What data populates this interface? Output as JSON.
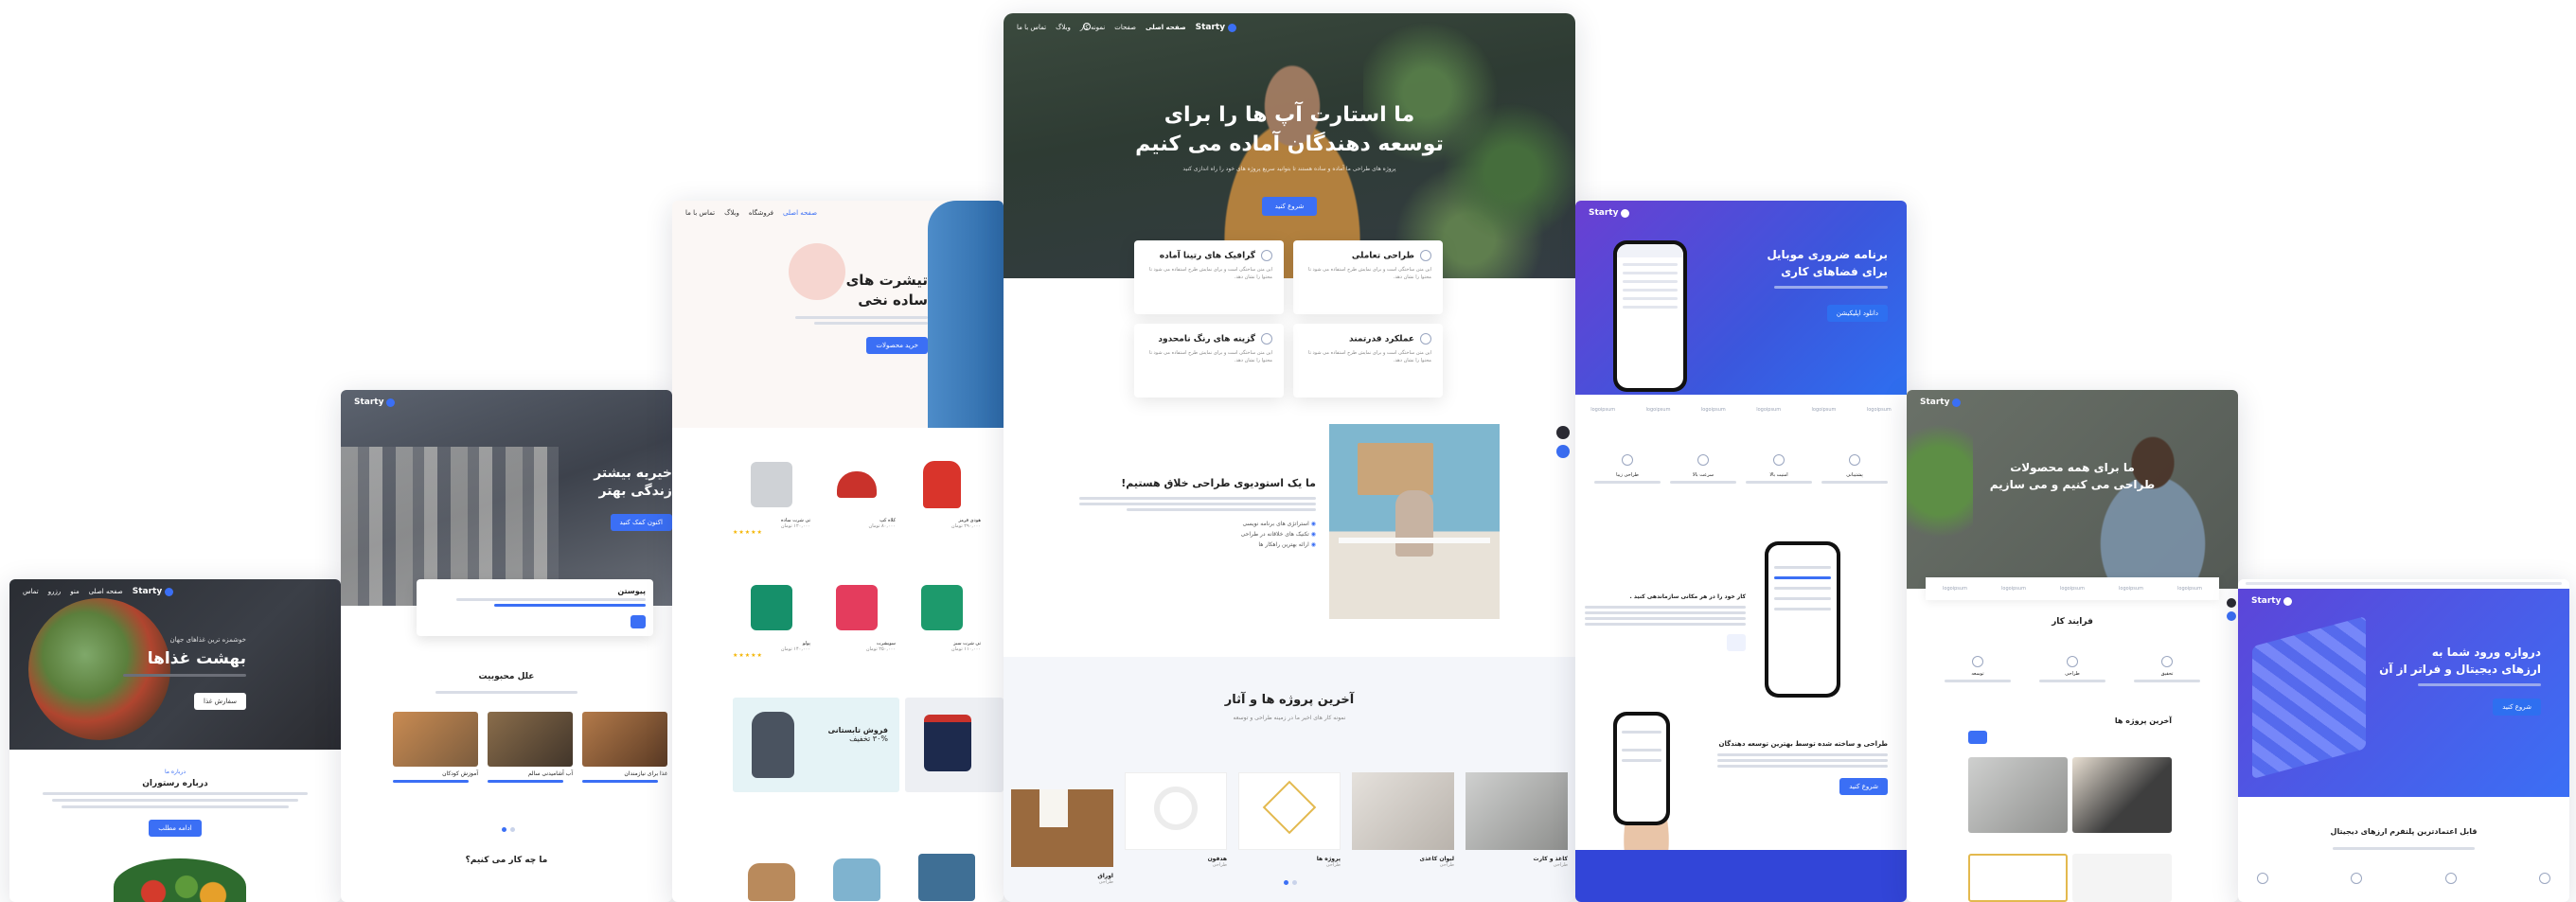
{
  "brand": "Starty",
  "colors": {
    "accent": "#3b6ff5",
    "purple": "#5b3fd6",
    "dark": "#2b2b33"
  },
  "main_hero": {
    "nav": [
      "صفحه اصلی",
      "صفحات",
      "نمونه کار",
      "وبلاگ",
      "تماس با ما"
    ],
    "title_line1": "ما استارت آپ ها را برای",
    "title_line2": "توسعه دهندگان آماده می کنیم",
    "subtitle": "پروژه های طراحی ما آماده و ساده هستند تا بتوانید سریع پروژه های خود را راه اندازی کنید",
    "cta": "شروع کنید"
  },
  "features": [
    {
      "title": "طراحی تعاملی",
      "text": "این متن ساختگی است و برای نمایش طرح استفاده می شود تا محتوا را نشان دهد."
    },
    {
      "title": "گرافیک های رتینا آماده",
      "text": "این متن ساختگی است و برای نمایش طرح استفاده می شود تا محتوا را نشان دهد."
    },
    {
      "title": "عملکرد قدرتمند",
      "text": "این متن ساختگی است و برای نمایش طرح استفاده می شود تا محتوا را نشان دهد."
    },
    {
      "title": "گزینه های رنگ نامحدود",
      "text": "این متن ساختگی است و برای نمایش طرح استفاده می شود تا محتوا را نشان دهد."
    }
  ],
  "studio": {
    "title": "ما یک استودیوی طراحی خلاق هستیم!",
    "points": [
      "استراتژی های برنامه نویسی",
      "تکنیک های خلاقانه در طراحی",
      "ارائه بهترین راهکار ها"
    ]
  },
  "projects": {
    "title": "آخرین پروژه ها و آثار",
    "subtitle": "نمونه کار های اخیر ما در زمینه طراحی و توسعه",
    "items": [
      {
        "name": "کاغذ و کارت",
        "cat": "طراحی"
      },
      {
        "name": "لیوان کاغذی",
        "cat": "طراحی"
      },
      {
        "name": "پروژه ها",
        "cat": "طراحی"
      },
      {
        "name": "هدفون",
        "cat": "طراحی"
      },
      {
        "name": "اوراق",
        "cat": "طراحی"
      }
    ]
  },
  "shop": {
    "title_line1": "تیشرت های",
    "title_line2": "ساده نخی",
    "cta": "خرید محصولات",
    "nav": [
      "صفحه اصلی",
      "فروشگاه",
      "وبلاگ",
      "تماس با ما"
    ],
    "products": [
      {
        "name": "هودی قرمز",
        "price": "۲۹۰,۰۰۰ تومان"
      },
      {
        "name": "کلاه کپ",
        "price": "۸۰,۰۰۰ تومان"
      },
      {
        "name": "تی شرت ساده",
        "price": "۱۲۰,۰۰۰ تومان"
      },
      {
        "name": "تی شرت سبز",
        "price": "۱۱۰,۰۰۰ تومان"
      },
      {
        "name": "سویشرت",
        "price": "۲۵۰,۰۰۰ تومان"
      },
      {
        "name": "پولو",
        "price": "۱۴۰,۰۰۰ تومان"
      }
    ],
    "promo_title": "فروش تابستانی",
    "promo_sub": "۳۰% تخفیف"
  },
  "charity": {
    "title_line1": "خیریه بیشتر",
    "title_line2": "زندگی بهتر",
    "cta": "اکنون کمک کنید",
    "donate_title": "پیوستن",
    "causes_title": "علل محبوبیت",
    "causes": [
      "آموزش کودکان",
      "آب آشامیدنی سالم",
      "غذا برای نیازمندان"
    ],
    "bottom_title": "ما چه کار می کنیم؟"
  },
  "food": {
    "nav": [
      "صفحه اصلی",
      "منو",
      "رزرو",
      "تماس"
    ],
    "kicker": "خوشمزه ترین غذاهای جهان",
    "title": "بهشت غذاها",
    "cta": "سفارش غذا",
    "about_kicker": "درباره ما",
    "about_title": "درباره رستوران",
    "about_btn": "ادامه مطلب"
  },
  "app": {
    "title_line1": "برنامه ضروری موبایل",
    "title_line2": "برای فضاهای کاری",
    "cta": "دانلود اپلیکیشن",
    "partners": [
      "logoipsum",
      "logoipsum",
      "logoipsum",
      "logoipsum",
      "logoipsum",
      "logoipsum"
    ],
    "features": [
      "پشتیبانی",
      "امنیت بالا",
      "سرعت بالا",
      "طراحی زیبا"
    ],
    "section_title": "کار خود را در هر مکانی سازماندهی کنید .",
    "section2_title": "طراحی و ساخته شده توسط بهترین توسعه دهندگان",
    "btn": "شروع کنید"
  },
  "freelance": {
    "title_line1": "ما برای همه محصولات",
    "title_line2": "طراحی می کنیم و می سازیم",
    "process_title": "فرایند کار",
    "steps": [
      "تحقیق",
      "طراحی",
      "توسعه"
    ],
    "projects_title": "آخرین پروژه ها"
  },
  "agency": {
    "title_line1": "دروازه ورود شما به",
    "title_line2": "ارزهای دیجیتال و فراتر از آن",
    "cta": "شروع کنید",
    "section_title": "قابل اعتمادترین پلتفرم ارزهای دیجیتال"
  }
}
